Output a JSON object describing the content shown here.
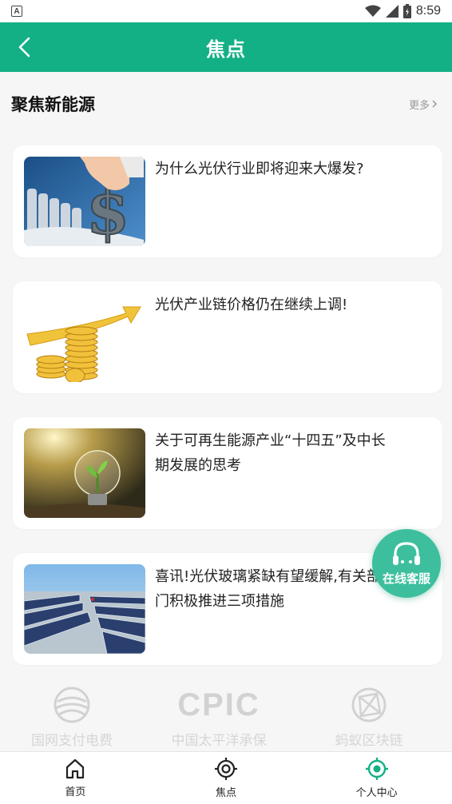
{
  "status_bar": {
    "time": "8:59",
    "notification_icon": "A",
    "icons": [
      "wifi-icon",
      "signal-icon",
      "battery-icon"
    ]
  },
  "header": {
    "title": "焦点",
    "back_icon": "chevron-left-icon"
  },
  "colors": {
    "primary": "#14b085",
    "float_button": "#3dbf9e"
  },
  "section": {
    "title": "聚焦新能源",
    "more_label": "更多",
    "more_icon": "chevron-right-icon"
  },
  "articles": [
    {
      "title": "为什么光伏行业即将迎来大爆发?"
    },
    {
      "title": "光伏产业链价格仍在继续上调!"
    },
    {
      "title": "关于可再生能源产业“十四五”及中长期发展的思考"
    },
    {
      "title": "喜讯!光伏玻璃紧缺有望缓解,有关部门积极推进三项措施"
    }
  ],
  "partners": [
    {
      "name": "国网支付电费"
    },
    {
      "name": "中国太平洋承保",
      "logo_text": "CPIC"
    },
    {
      "name": "蚂蚁区块链"
    }
  ],
  "float_button": {
    "label": "在线客服",
    "icon": "headset-icon"
  },
  "tabs": [
    {
      "label": "首页",
      "icon": "home-icon"
    },
    {
      "label": "焦点",
      "icon": "target-icon"
    },
    {
      "label": "个人中心",
      "icon": "profile-target-icon"
    }
  ]
}
